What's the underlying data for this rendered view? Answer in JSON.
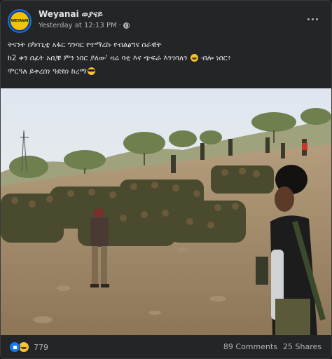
{
  "post": {
    "page_name": "Weyanai ወያናይ",
    "avatar_text": "WEYANAI",
    "timestamp": "Yesterday at 12:13 PM",
    "separator": "·",
    "text_line1": "ትናንት በካሳጊቲ አፋር ግንባር የተማረኩ የብልፅግና ሰራዊት",
    "text_line2a": "ከ2 ቀን በፊት አቢቹ ምን ነበር ያለው' ዛሬ ባቲ እና ጭፍራ እንገባለን",
    "text_line2b": "ብሎ ነበር፥",
    "text_line3": "ሞርዓለ ይቀረበነ ዓድከነ ከረማ"
  },
  "footer": {
    "reaction_count": "779",
    "comments": "89 Comments",
    "shares": "25 Shares"
  },
  "colors": {
    "background": "#242526",
    "accent": "#1877f2"
  },
  "icons": [
    "globe-icon",
    "more-icon",
    "laugh-emoji-icon",
    "sunglasses-emoji-icon",
    "like-icon",
    "haha-icon"
  ]
}
